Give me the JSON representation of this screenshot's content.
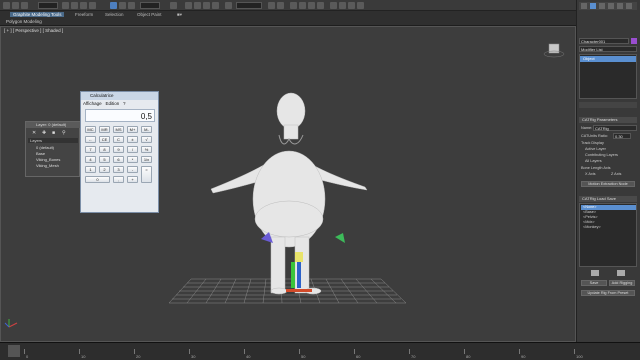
{
  "ribbon": {
    "tabs": [
      "Graphite Modeling Tools",
      "Freeform",
      "Selection",
      "Object Paint"
    ],
    "sub_label": "Polygon Modeling"
  },
  "viewport": {
    "label": "[ + ] [ Perspective ] [ Shaded ]"
  },
  "command_panel": {
    "object_name": "Character001",
    "modifier_list": "Modifier List",
    "stack_item": "Object",
    "catrig_title": "CATRig Parameters",
    "name_label": "Name:",
    "name_value": "CATRig",
    "scale_label": "CATUnits Ratio:",
    "scale_value": "0.30",
    "track_display": "Track Display",
    "opt_active": "Active Layer",
    "opt_contributing": "Contributing Layers",
    "opt_all": "All Layers",
    "bone_axis": "Bone Length Axis",
    "opt_x": "X Axis",
    "opt_z": "Z Axis",
    "extraction_btn": "Motion Extraction Node",
    "load_save_title": "CATRig Load Save",
    "presets": [
      "<None>",
      "<Base>",
      "<Pelvis>",
      "<Mdx>",
      "<Monkey>"
    ],
    "save_btn": "Save",
    "add_rigging_btn": "Add Rigging",
    "update_btn": "Update Rig From Preset"
  },
  "calculator": {
    "title": "Calculatrice",
    "menu": [
      "Affichage",
      "Edition",
      "?"
    ],
    "display": "0,5",
    "keys": [
      "MC",
      "MR",
      "MS",
      "M+",
      "M-",
      "←",
      "CE",
      "C",
      "±",
      "√",
      "7",
      "8",
      "9",
      "/",
      "%",
      "4",
      "5",
      "6",
      "*",
      "1/x",
      "1",
      "2",
      "3",
      "-",
      "=",
      "0",
      ",",
      "+"
    ]
  },
  "layers_panel": {
    "title": "Layer: 0 (default)",
    "header": "Layers",
    "rows": [
      "0 (default)",
      "Base",
      "Viking_Bones",
      "Viking_Mesh"
    ]
  },
  "timeline": {
    "labels": [
      "0",
      "10",
      "20",
      "30",
      "40",
      "50",
      "60",
      "70",
      "80",
      "90",
      "100"
    ]
  },
  "colors": {
    "accent": "#4a6a8a",
    "selected": "#5a8fd0",
    "mesh": "#e8e8e8"
  }
}
